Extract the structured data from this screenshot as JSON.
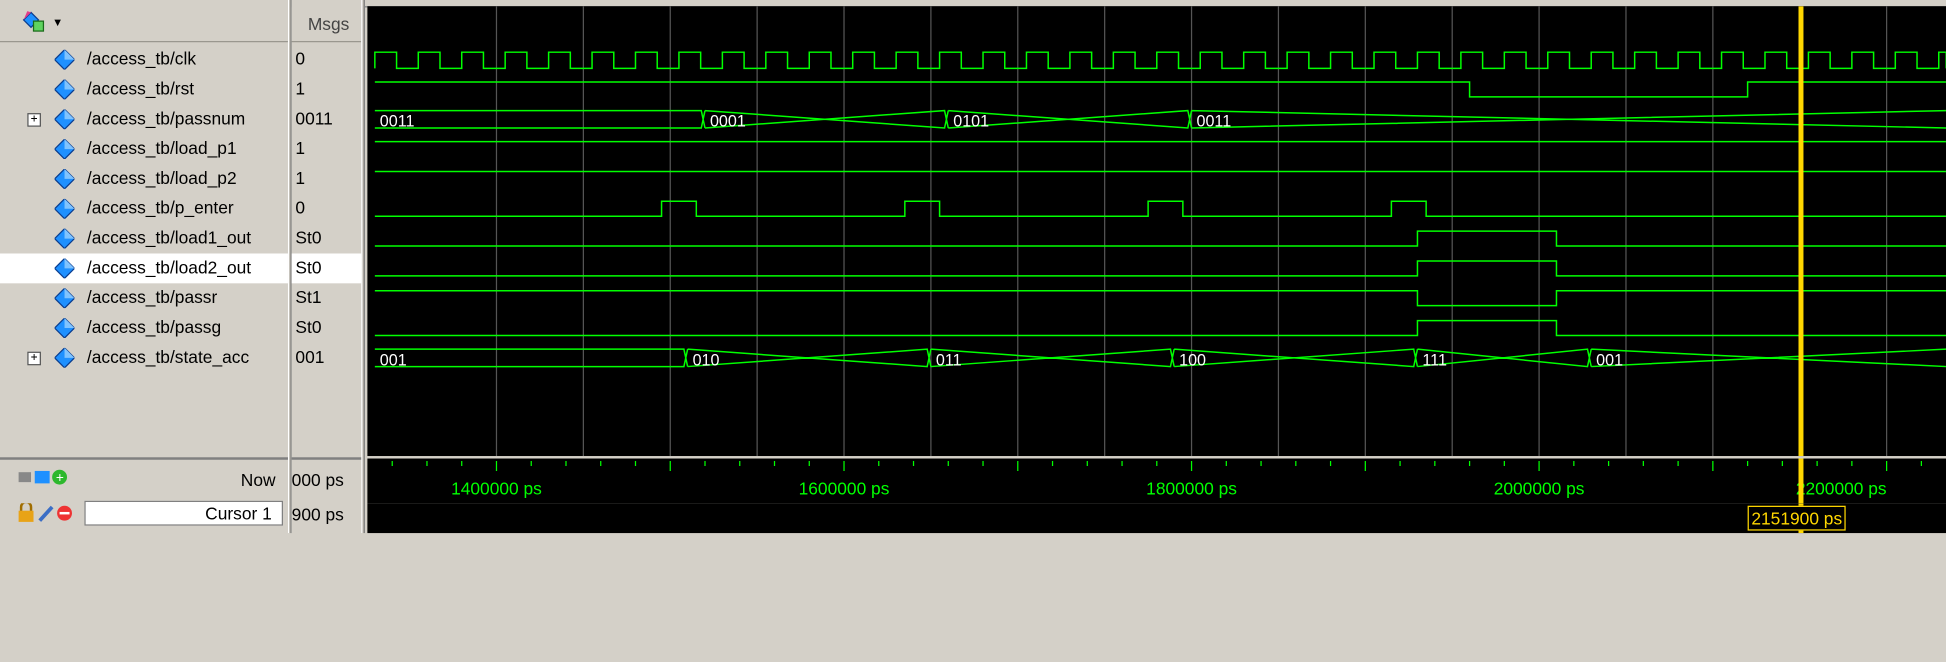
{
  "header": {
    "msgs_label": "Msgs"
  },
  "signals": [
    {
      "name": "/access_tb/clk",
      "value": "0",
      "expandable": false,
      "selected": false
    },
    {
      "name": "/access_tb/rst",
      "value": "1",
      "expandable": false,
      "selected": false
    },
    {
      "name": "/access_tb/passnum",
      "value": "0011",
      "expandable": true,
      "selected": false
    },
    {
      "name": "/access_tb/load_p1",
      "value": "1",
      "expandable": false,
      "selected": false
    },
    {
      "name": "/access_tb/load_p2",
      "value": "1",
      "expandable": false,
      "selected": false
    },
    {
      "name": "/access_tb/p_enter",
      "value": "0",
      "expandable": false,
      "selected": false
    },
    {
      "name": "/access_tb/load1_out",
      "value": "St0",
      "expandable": false,
      "selected": false
    },
    {
      "name": "/access_tb/load2_out",
      "value": "St0",
      "expandable": false,
      "selected": true
    },
    {
      "name": "/access_tb/passr",
      "value": "St1",
      "expandable": false,
      "selected": false
    },
    {
      "name": "/access_tb/passg",
      "value": "St0",
      "expandable": false,
      "selected": false
    },
    {
      "name": "/access_tb/state_acc",
      "value": "001",
      "expandable": true,
      "selected": false
    }
  ],
  "bus_labels": {
    "passnum": [
      "0011",
      "0001",
      "0101",
      "0011"
    ],
    "state_acc": [
      "001",
      "010",
      "011",
      "100",
      "111",
      "001"
    ]
  },
  "footer": {
    "now_label": "Now",
    "now_value": "000 ps",
    "cursor_label": "Cursor 1",
    "cursor_value": "900 ps",
    "cursor_time": "2151900 ps"
  },
  "ruler": {
    "labels": [
      "1400000 ps",
      "1600000 ps",
      "1800000 ps",
      "2000000 ps",
      "2200000 ps"
    ]
  },
  "colors": {
    "wave": "#00ff00",
    "cursor": "#ffd700",
    "grid": "#555555",
    "icon": "#1e90ff"
  }
}
